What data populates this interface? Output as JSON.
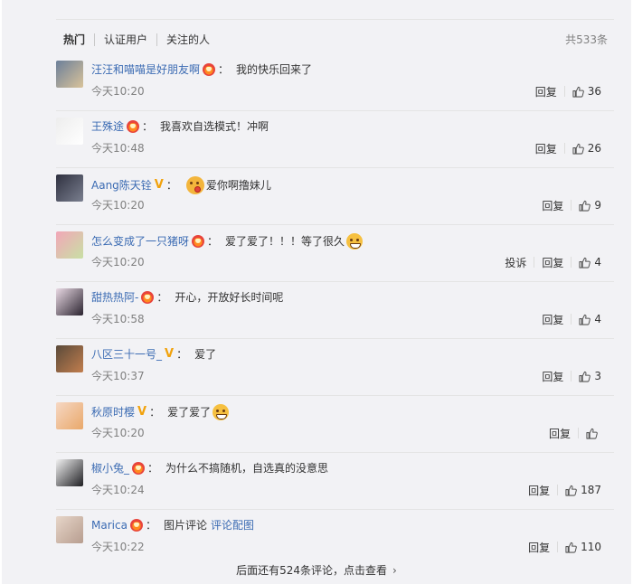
{
  "header": {
    "tabs": [
      "热门",
      "认证用户",
      "关注的人"
    ],
    "total": "共533条"
  },
  "comments": [
    {
      "user": "汪汪和喵喵是好朋友啊",
      "badge": "vip",
      "text": "我的快乐回来了",
      "emoji": "",
      "link": "",
      "time": "今天10:20",
      "report": "",
      "reply": "回复",
      "likes": "36",
      "avatar_colors": [
        "#6c7f9a",
        "#d9c39a"
      ]
    },
    {
      "user": "王殊途",
      "badge": "vip",
      "text": "我喜欢自选模式！冲啊",
      "emoji": "",
      "link": "",
      "time": "今天10:48",
      "report": "",
      "reply": "回复",
      "likes": "26",
      "avatar_colors": [
        "#ededed",
        "#ffffff"
      ]
    },
    {
      "user": "Aang陈天铨",
      "badge": "v",
      "text": "爱你啊撸妹儿",
      "emoji": "kiss",
      "link": "",
      "time": "今天10:20",
      "report": "",
      "reply": "回复",
      "likes": "9",
      "avatar_colors": [
        "#2f3140",
        "#7a7f8f"
      ]
    },
    {
      "user": "怎么变成了一只猪呀",
      "badge": "vip",
      "text": "爱了爱了！！！等了很久",
      "emoji": "grin",
      "link": "",
      "time": "今天10:20",
      "report": "投诉",
      "reply": "回复",
      "likes": "4",
      "avatar_colors": [
        "#f2a6b8",
        "#c8e0a4"
      ]
    },
    {
      "user": "甜热热阿-",
      "badge": "vip",
      "text": "开心，开放好长时间呢",
      "emoji": "",
      "link": "",
      "time": "今天10:58",
      "report": "",
      "reply": "回复",
      "likes": "4",
      "avatar_colors": [
        "#e9d9e4",
        "#2b2430"
      ]
    },
    {
      "user": "八区三十一号_",
      "badge": "v",
      "text": "爱了",
      "emoji": "",
      "link": "",
      "time": "今天10:37",
      "report": "",
      "reply": "回复",
      "likes": "3",
      "avatar_colors": [
        "#5a4a3a",
        "#c27e4e"
      ]
    },
    {
      "user": "秋原时樱",
      "badge": "v",
      "text": "爱了爱了",
      "emoji": "grin",
      "link": "",
      "time": "今天10:20",
      "report": "",
      "reply": "回复",
      "likes": "",
      "avatar_colors": [
        "#f6d8c4",
        "#e9a86a"
      ]
    },
    {
      "user": "椒小兔_",
      "badge": "vip",
      "text": "为什么不搞随机，自选真的没意思",
      "emoji": "",
      "link": "",
      "time": "今天10:24",
      "report": "",
      "reply": "回复",
      "likes": "187",
      "avatar_colors": [
        "#f2f2f2",
        "#1f1f23"
      ]
    },
    {
      "user": "Marica",
      "badge": "vip",
      "text": "图片评论",
      "emoji": "",
      "link": "评论配图",
      "time": "今天10:22",
      "report": "",
      "reply": "回复",
      "likes": "110",
      "avatar_colors": [
        "#e7d6c9",
        "#b79d8f"
      ]
    }
  ],
  "footer": {
    "more_text": "后面还有524条评论，点击查看",
    "more_arrow": "›"
  }
}
